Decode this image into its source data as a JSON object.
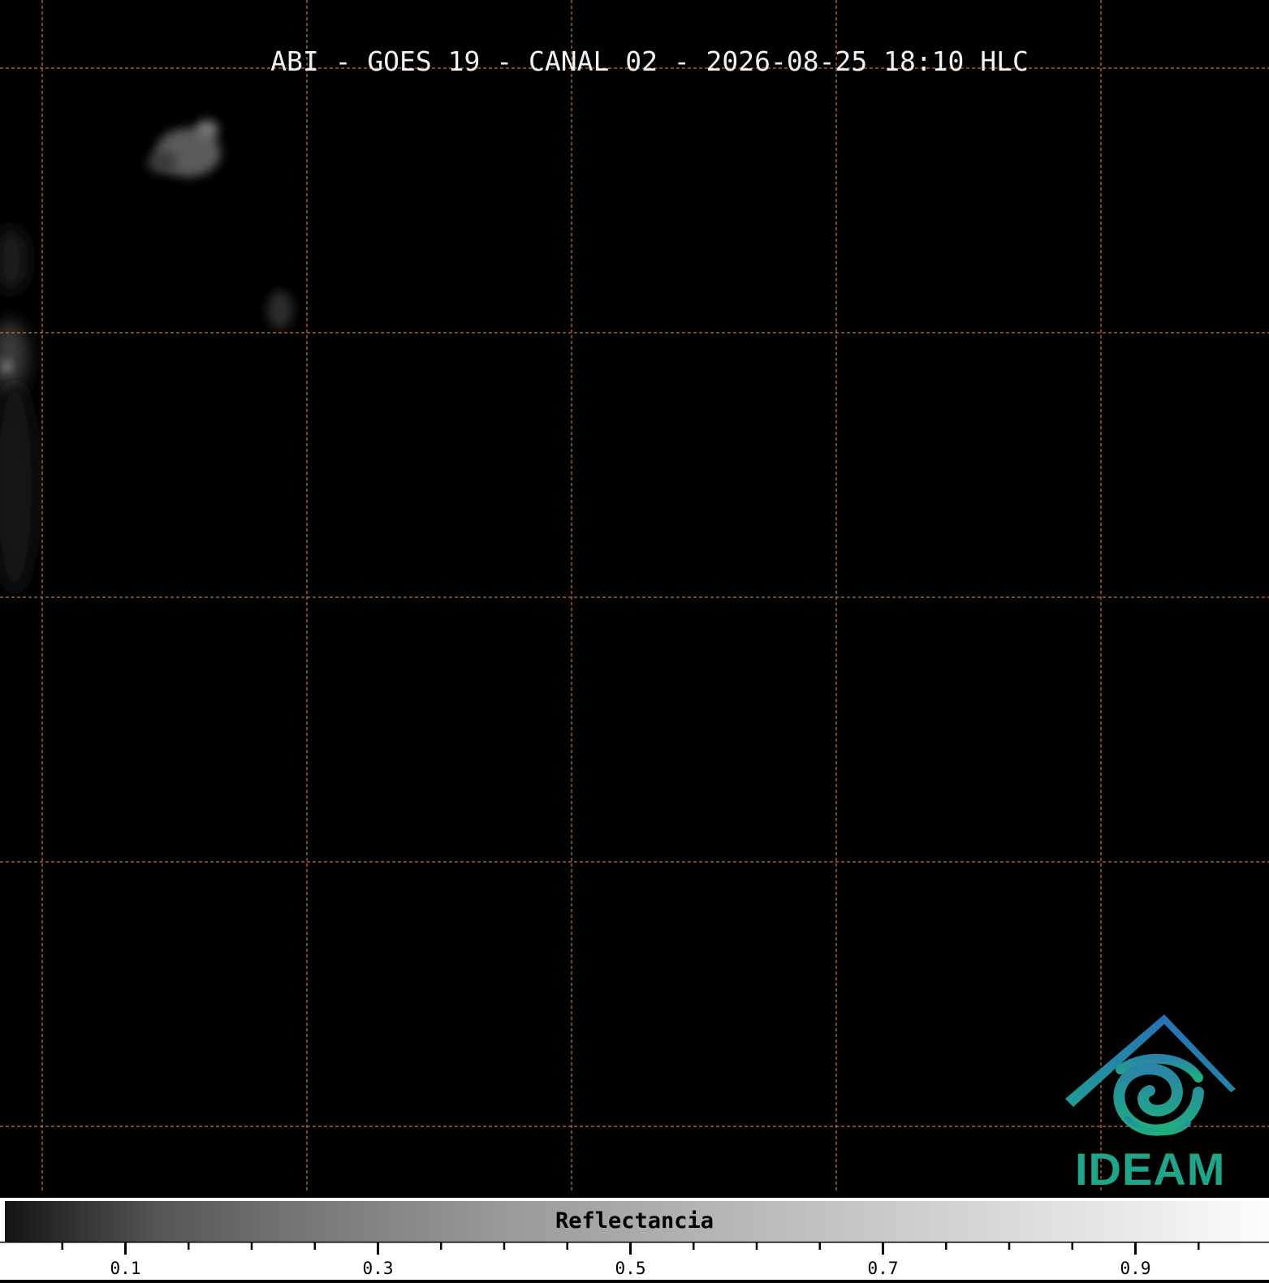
{
  "title": "ABI - GOES 19 - CANAL 02 - 2026-08-25 18:10 HLC",
  "colorbar": {
    "label": "Reflectancia",
    "range": [
      0.0,
      1.0
    ],
    "major_ticks": [
      0.1,
      0.3,
      0.5,
      0.7,
      0.9
    ],
    "major_tick_labels": [
      "0.1",
      "0.3",
      "0.5",
      "0.7",
      "0.9"
    ],
    "minor_ticks": [
      0.05,
      0.15,
      0.2,
      0.25,
      0.35,
      0.4,
      0.45,
      0.55,
      0.6,
      0.65,
      0.75,
      0.8,
      0.85,
      0.95
    ],
    "colormap": [
      "#141414",
      "#fcfcfc"
    ]
  },
  "map": {
    "background_color": "#000000",
    "gridline_color": "#c8743a",
    "gridline_style": "dashed"
  },
  "logo": {
    "text": "IDEAM",
    "text_color": "#1fa58a",
    "roof_color": "#2a6fb5",
    "swirl_color": "#1f9e96"
  }
}
